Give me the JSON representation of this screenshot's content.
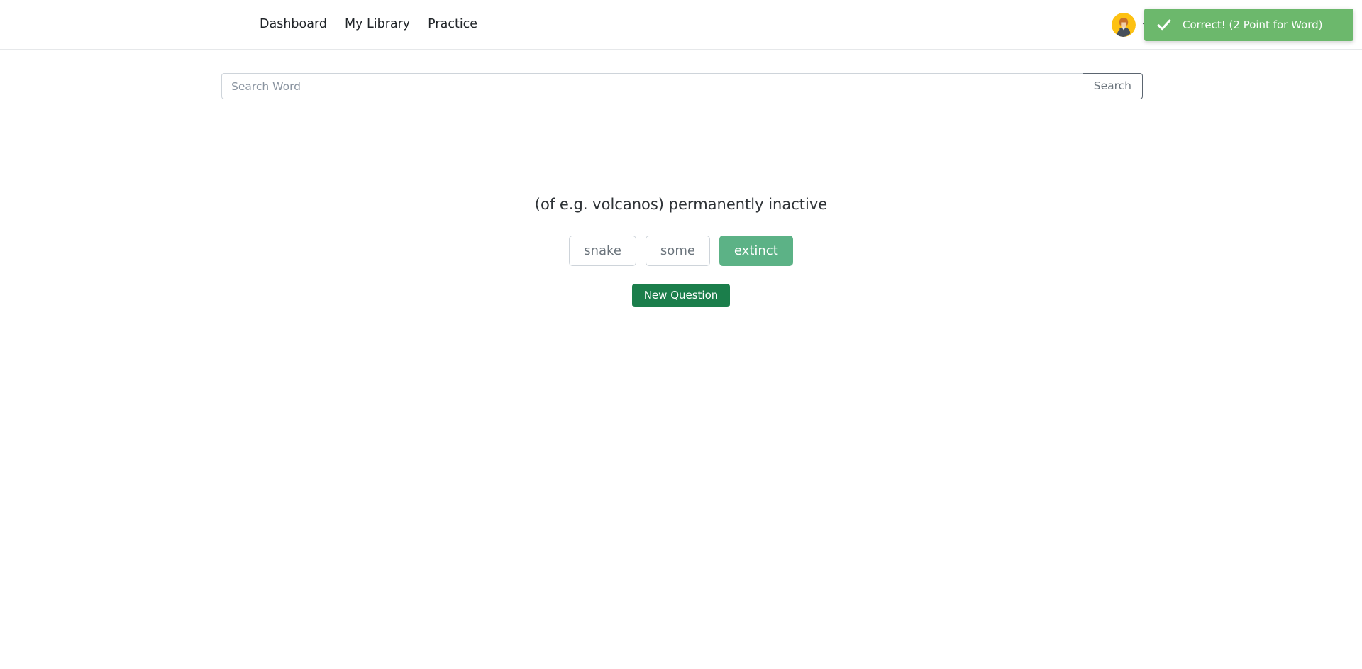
{
  "navbar": {
    "links": [
      {
        "label": "Dashboard"
      },
      {
        "label": "My Library"
      },
      {
        "label": "Practice"
      }
    ],
    "account": {
      "avatar_icon": "user-avatar-icon",
      "caret_icon": "chevron-down-icon"
    }
  },
  "search": {
    "placeholder": "Search Word",
    "value": "",
    "button_label": "Search"
  },
  "main": {
    "question": "(of e.g. volcanos) permanently inactive",
    "choices": [
      {
        "label": "snake",
        "selected": false
      },
      {
        "label": "some",
        "selected": false
      },
      {
        "label": "extinct",
        "selected": true
      }
    ],
    "new_question_label": "New Question"
  },
  "toast": {
    "message": "Correct! (2 Point for Word)",
    "icon": "check-icon",
    "background": "#6cb86c",
    "text_color": "#ffffff"
  },
  "colors": {
    "selected_choice": "#5cb286",
    "primary_action": "#1b7e4b",
    "toast_success": "#6cb86c",
    "muted_text": "#6c757d",
    "border": "#ced4da"
  }
}
